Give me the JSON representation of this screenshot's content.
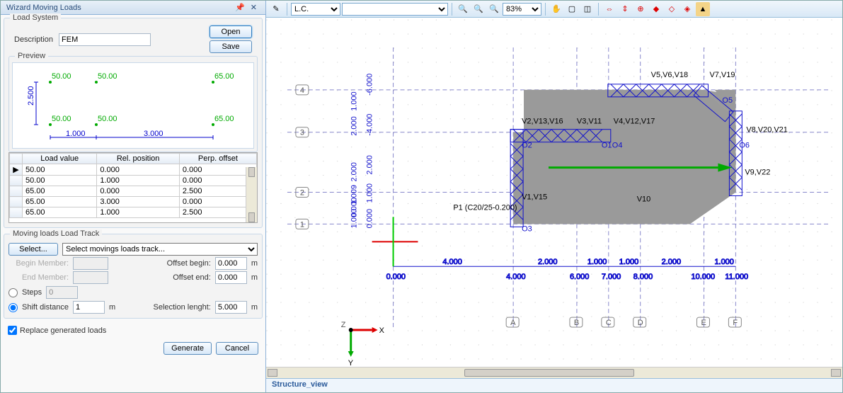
{
  "panel": {
    "title": "Wizard Moving Loads",
    "loadsystem_label": "Load System",
    "description_label": "Description",
    "description_value": "FEM",
    "open": "Open",
    "save": "Save",
    "preview_label": "Preview"
  },
  "preview": {
    "loads": [
      "50.00",
      "50.00",
      "65.00",
      "50.00",
      "50.00",
      "65.00"
    ],
    "dim_v": "2.500",
    "dim_h1": "1.000",
    "dim_h2": "3.000"
  },
  "table": {
    "headers": [
      "Load value",
      "Rel. position",
      "Perp. offset"
    ],
    "rows": [
      [
        "50.00",
        "0.000",
        "0.000"
      ],
      [
        "50.00",
        "1.000",
        "0.000"
      ],
      [
        "65.00",
        "0.000",
        "2.500"
      ],
      [
        "65.00",
        "3.000",
        "0.000"
      ],
      [
        "65.00",
        "1.000",
        "2.500"
      ]
    ]
  },
  "track": {
    "group_label": "Moving loads Load Track",
    "select_btn": "Select...",
    "select_placeholder": "Select movings loads track...",
    "begin_member": "Begin Member:",
    "end_member": "End Member:",
    "offset_begin_label": "Offset begin:",
    "offset_begin": "0.000",
    "offset_end_label": "Offset end:",
    "offset_end": "0.000",
    "unit": "m",
    "steps_label": "Steps",
    "steps": "0",
    "shift_label": "Shift distance",
    "shift": "1",
    "sel_len_label": "Selection lenght:",
    "sel_len": "5.000"
  },
  "replace_label": "Replace generated loads",
  "generate": "Generate",
  "cancel": "Cancel",
  "toolbar": {
    "lc_label": "L.C.",
    "zoom": "83%"
  },
  "canvas": {
    "vgrid_labels": [
      "1",
      "2",
      "3",
      "4"
    ],
    "hgrid_labels": [
      "A",
      "B",
      "C",
      "D",
      "E",
      "F"
    ],
    "vlabs": [
      "V5,V6,V18",
      "V7,V19",
      "V2,V13,V16",
      "V3,V11",
      "V4,V12,V17",
      "V8,V20,V21",
      "V1,V15",
      "V10",
      "V9,V22"
    ],
    "p1": "P1 (C20/25-0.200)",
    "dims_h": [
      "4.000",
      "2.000",
      "1.000",
      "1.000",
      "2.000",
      "1.000"
    ],
    "dims_total_h": [
      "0.000",
      "4.000",
      "6.000",
      "7.000",
      "8.000",
      "10.000",
      "11.000"
    ],
    "dims_v": [
      "1.000",
      "0.000",
      "1.009",
      "2.000",
      "2.000",
      "1.000",
      "2.000"
    ],
    "dims_v2": [
      "0.000",
      "1.000",
      "2.000",
      "-4.000",
      "-6.000"
    ],
    "olabels": [
      "O1",
      "O2",
      "O3",
      "O4",
      "O5",
      "O6"
    ],
    "axis": {
      "x": "X",
      "y": "Y",
      "z": "Z"
    }
  },
  "status_tab": "Structure_view",
  "chart_data": {
    "type": "table",
    "title": "Moving Loads",
    "columns": [
      "Load value",
      "Rel. position",
      "Perp. offset"
    ],
    "rows": [
      [
        50.0,
        0.0,
        0.0
      ],
      [
        50.0,
        1.0,
        0.0
      ],
      [
        65.0,
        0.0,
        2.5
      ],
      [
        65.0,
        3.0,
        0.0
      ],
      [
        65.0,
        1.0,
        2.5
      ]
    ],
    "geometry_x_gridlines": [
      0,
      4,
      6,
      7,
      8,
      10,
      11
    ],
    "geometry_y_gridlines": [
      0,
      -1,
      -2,
      -4,
      -6
    ]
  }
}
